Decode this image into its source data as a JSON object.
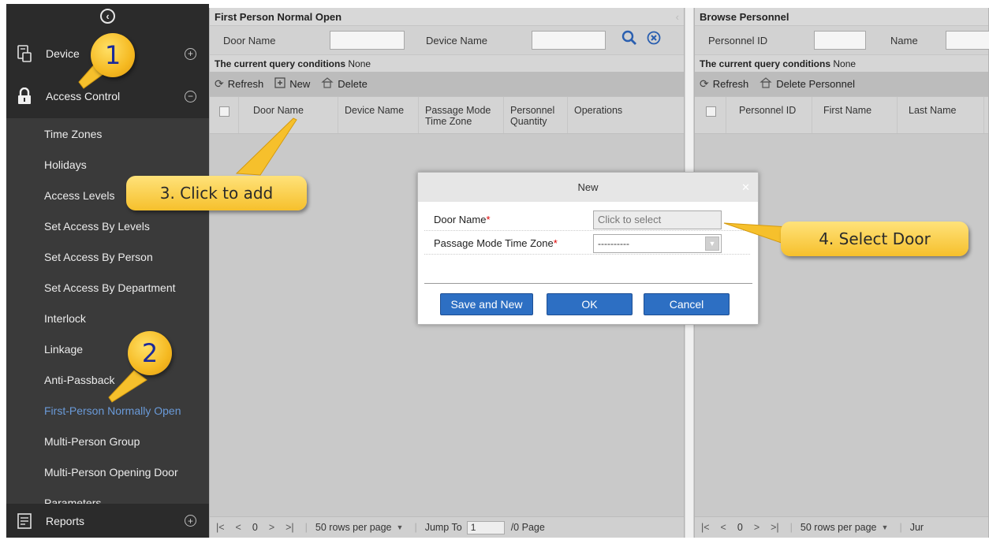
{
  "sidebar": {
    "device_label": "Device",
    "access_label": "Access Control",
    "reports_label": "Reports",
    "items": [
      {
        "label": "Time Zones"
      },
      {
        "label": "Holidays"
      },
      {
        "label": "Access Levels"
      },
      {
        "label": "Set Access By Levels"
      },
      {
        "label": "Set Access By Person"
      },
      {
        "label": "Set Access By Department"
      },
      {
        "label": "Interlock"
      },
      {
        "label": "Linkage"
      },
      {
        "label": "Anti-Passback"
      },
      {
        "label": "First-Person Normally Open"
      },
      {
        "label": "Multi-Person Group"
      },
      {
        "label": "Multi-Person Opening Door"
      },
      {
        "label": "Parameters"
      }
    ]
  },
  "left_panel": {
    "title": "First Person Normal Open",
    "door_name_label": "Door Name",
    "device_name_label": "Device Name",
    "query_label": "The current query conditions",
    "query_value": "None",
    "refresh": "Refresh",
    "new": "New",
    "delete": "Delete",
    "columns": [
      "Door Name",
      "Device Name",
      "Passage Mode Time Zone",
      "Personnel Quantity",
      "Operations"
    ],
    "footer": {
      "page": "0",
      "rows_per_page": "50 rows per page",
      "jump_to": "Jump To",
      "jump_value": "1",
      "pages": "/0 Page"
    }
  },
  "right_panel": {
    "title": "Browse Personnel",
    "personnel_id_label": "Personnel ID",
    "name_label": "Name",
    "query_label": "The current query conditions",
    "query_value": "None",
    "refresh": "Refresh",
    "delete_personnel": "Delete Personnel",
    "columns": [
      "Personnel ID",
      "First Name",
      "Last Name"
    ],
    "footer": {
      "page": "0",
      "rows_per_page": "50 rows per page",
      "jump_to": "Jur"
    }
  },
  "dialog": {
    "title": "New",
    "door_name_label": "Door Name",
    "door_name_placeholder": "Click to select",
    "passage_label": "Passage Mode Time Zone",
    "passage_value": "----------",
    "required_mark": "*",
    "save_new": "Save and New",
    "ok": "OK",
    "cancel": "Cancel"
  },
  "callouts": {
    "step1": "1",
    "step2": "2",
    "step3": "3. Click to add",
    "step4": "4. Select Door"
  },
  "colors": {
    "accent": "#2d6fc3",
    "callout": "#f6c02c",
    "active_item": "#6a9ad8"
  }
}
